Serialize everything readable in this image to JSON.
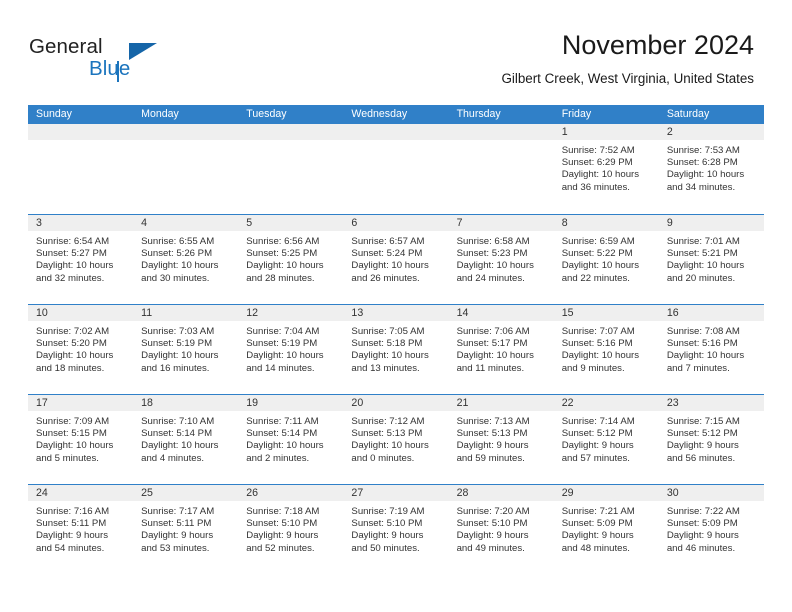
{
  "brand": {
    "line1": "General",
    "line2": "Blue",
    "accent_color": "#1b74bd",
    "triangle_icon": "triangle-icon"
  },
  "header": {
    "title": "November 2024",
    "subtitle": "Gilbert Creek, West Virginia, United States"
  },
  "calendar": {
    "header_bg": "#3080c8",
    "daynum_bg": "#efefef",
    "weekdays": [
      "Sunday",
      "Monday",
      "Tuesday",
      "Wednesday",
      "Thursday",
      "Friday",
      "Saturday"
    ],
    "weeks": [
      [
        {
          "day": "",
          "lines": []
        },
        {
          "day": "",
          "lines": []
        },
        {
          "day": "",
          "lines": []
        },
        {
          "day": "",
          "lines": []
        },
        {
          "day": "",
          "lines": []
        },
        {
          "day": "1",
          "lines": [
            "Sunrise: 7:52 AM",
            "Sunset: 6:29 PM",
            "Daylight: 10 hours",
            "and 36 minutes."
          ]
        },
        {
          "day": "2",
          "lines": [
            "Sunrise: 7:53 AM",
            "Sunset: 6:28 PM",
            "Daylight: 10 hours",
            "and 34 minutes."
          ]
        }
      ],
      [
        {
          "day": "3",
          "lines": [
            "Sunrise: 6:54 AM",
            "Sunset: 5:27 PM",
            "Daylight: 10 hours",
            "and 32 minutes."
          ]
        },
        {
          "day": "4",
          "lines": [
            "Sunrise: 6:55 AM",
            "Sunset: 5:26 PM",
            "Daylight: 10 hours",
            "and 30 minutes."
          ]
        },
        {
          "day": "5",
          "lines": [
            "Sunrise: 6:56 AM",
            "Sunset: 5:25 PM",
            "Daylight: 10 hours",
            "and 28 minutes."
          ]
        },
        {
          "day": "6",
          "lines": [
            "Sunrise: 6:57 AM",
            "Sunset: 5:24 PM",
            "Daylight: 10 hours",
            "and 26 minutes."
          ]
        },
        {
          "day": "7",
          "lines": [
            "Sunrise: 6:58 AM",
            "Sunset: 5:23 PM",
            "Daylight: 10 hours",
            "and 24 minutes."
          ]
        },
        {
          "day": "8",
          "lines": [
            "Sunrise: 6:59 AM",
            "Sunset: 5:22 PM",
            "Daylight: 10 hours",
            "and 22 minutes."
          ]
        },
        {
          "day": "9",
          "lines": [
            "Sunrise: 7:01 AM",
            "Sunset: 5:21 PM",
            "Daylight: 10 hours",
            "and 20 minutes."
          ]
        }
      ],
      [
        {
          "day": "10",
          "lines": [
            "Sunrise: 7:02 AM",
            "Sunset: 5:20 PM",
            "Daylight: 10 hours",
            "and 18 minutes."
          ]
        },
        {
          "day": "11",
          "lines": [
            "Sunrise: 7:03 AM",
            "Sunset: 5:19 PM",
            "Daylight: 10 hours",
            "and 16 minutes."
          ]
        },
        {
          "day": "12",
          "lines": [
            "Sunrise: 7:04 AM",
            "Sunset: 5:19 PM",
            "Daylight: 10 hours",
            "and 14 minutes."
          ]
        },
        {
          "day": "13",
          "lines": [
            "Sunrise: 7:05 AM",
            "Sunset: 5:18 PM",
            "Daylight: 10 hours",
            "and 13 minutes."
          ]
        },
        {
          "day": "14",
          "lines": [
            "Sunrise: 7:06 AM",
            "Sunset: 5:17 PM",
            "Daylight: 10 hours",
            "and 11 minutes."
          ]
        },
        {
          "day": "15",
          "lines": [
            "Sunrise: 7:07 AM",
            "Sunset: 5:16 PM",
            "Daylight: 10 hours",
            "and 9 minutes."
          ]
        },
        {
          "day": "16",
          "lines": [
            "Sunrise: 7:08 AM",
            "Sunset: 5:16 PM",
            "Daylight: 10 hours",
            "and 7 minutes."
          ]
        }
      ],
      [
        {
          "day": "17",
          "lines": [
            "Sunrise: 7:09 AM",
            "Sunset: 5:15 PM",
            "Daylight: 10 hours",
            "and 5 minutes."
          ]
        },
        {
          "day": "18",
          "lines": [
            "Sunrise: 7:10 AM",
            "Sunset: 5:14 PM",
            "Daylight: 10 hours",
            "and 4 minutes."
          ]
        },
        {
          "day": "19",
          "lines": [
            "Sunrise: 7:11 AM",
            "Sunset: 5:14 PM",
            "Daylight: 10 hours",
            "and 2 minutes."
          ]
        },
        {
          "day": "20",
          "lines": [
            "Sunrise: 7:12 AM",
            "Sunset: 5:13 PM",
            "Daylight: 10 hours",
            "and 0 minutes."
          ]
        },
        {
          "day": "21",
          "lines": [
            "Sunrise: 7:13 AM",
            "Sunset: 5:13 PM",
            "Daylight: 9 hours",
            "and 59 minutes."
          ]
        },
        {
          "day": "22",
          "lines": [
            "Sunrise: 7:14 AM",
            "Sunset: 5:12 PM",
            "Daylight: 9 hours",
            "and 57 minutes."
          ]
        },
        {
          "day": "23",
          "lines": [
            "Sunrise: 7:15 AM",
            "Sunset: 5:12 PM",
            "Daylight: 9 hours",
            "and 56 minutes."
          ]
        }
      ],
      [
        {
          "day": "24",
          "lines": [
            "Sunrise: 7:16 AM",
            "Sunset: 5:11 PM",
            "Daylight: 9 hours",
            "and 54 minutes."
          ]
        },
        {
          "day": "25",
          "lines": [
            "Sunrise: 7:17 AM",
            "Sunset: 5:11 PM",
            "Daylight: 9 hours",
            "and 53 minutes."
          ]
        },
        {
          "day": "26",
          "lines": [
            "Sunrise: 7:18 AM",
            "Sunset: 5:10 PM",
            "Daylight: 9 hours",
            "and 52 minutes."
          ]
        },
        {
          "day": "27",
          "lines": [
            "Sunrise: 7:19 AM",
            "Sunset: 5:10 PM",
            "Daylight: 9 hours",
            "and 50 minutes."
          ]
        },
        {
          "day": "28",
          "lines": [
            "Sunrise: 7:20 AM",
            "Sunset: 5:10 PM",
            "Daylight: 9 hours",
            "and 49 minutes."
          ]
        },
        {
          "day": "29",
          "lines": [
            "Sunrise: 7:21 AM",
            "Sunset: 5:09 PM",
            "Daylight: 9 hours",
            "and 48 minutes."
          ]
        },
        {
          "day": "30",
          "lines": [
            "Sunrise: 7:22 AM",
            "Sunset: 5:09 PM",
            "Daylight: 9 hours",
            "and 46 minutes."
          ]
        }
      ]
    ]
  }
}
